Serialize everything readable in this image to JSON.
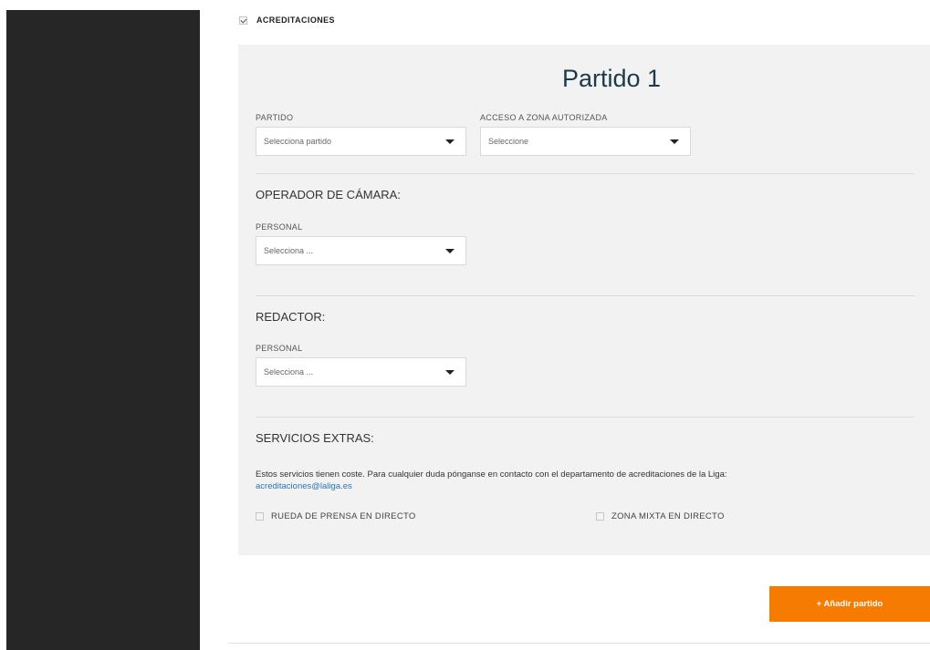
{
  "accreditation": {
    "label": "ACREDITACIONES",
    "checked": true
  },
  "match": {
    "title": "Partido 1",
    "partido": {
      "label": "PARTIDO",
      "value": "Selecciona partido"
    },
    "acceso": {
      "label": "ACCESO A ZONA AUTORIZADA",
      "value": "Seleccione"
    }
  },
  "camera": {
    "heading": "OPERADOR DE CÁMARA:",
    "label": "PERSONAL",
    "value": "Selecciona ..."
  },
  "writer": {
    "heading": "REDACTOR:",
    "label": "PERSONAL",
    "value": "Selecciona ..."
  },
  "extras": {
    "heading": "SERVICIOS EXTRAS:",
    "note": "Estos servicios tienen coste. Para cualquier duda pónganse en contacto con el departamento de acreditaciones de la Liga:",
    "email": "acreditaciones@laliga.es",
    "options": [
      {
        "label": "RUEDA DE PRENSA EN DIRECTO",
        "checked": false
      },
      {
        "label": "ZONA MIXTA EN DIRECTO",
        "checked": false
      }
    ]
  },
  "add_button": "+ Añadir partido",
  "colors": {
    "sidebar": "#262626",
    "panel": "#f2f2f2",
    "accent": "#f57c00",
    "link": "#2a75b8",
    "title": "#1d3a4a"
  }
}
